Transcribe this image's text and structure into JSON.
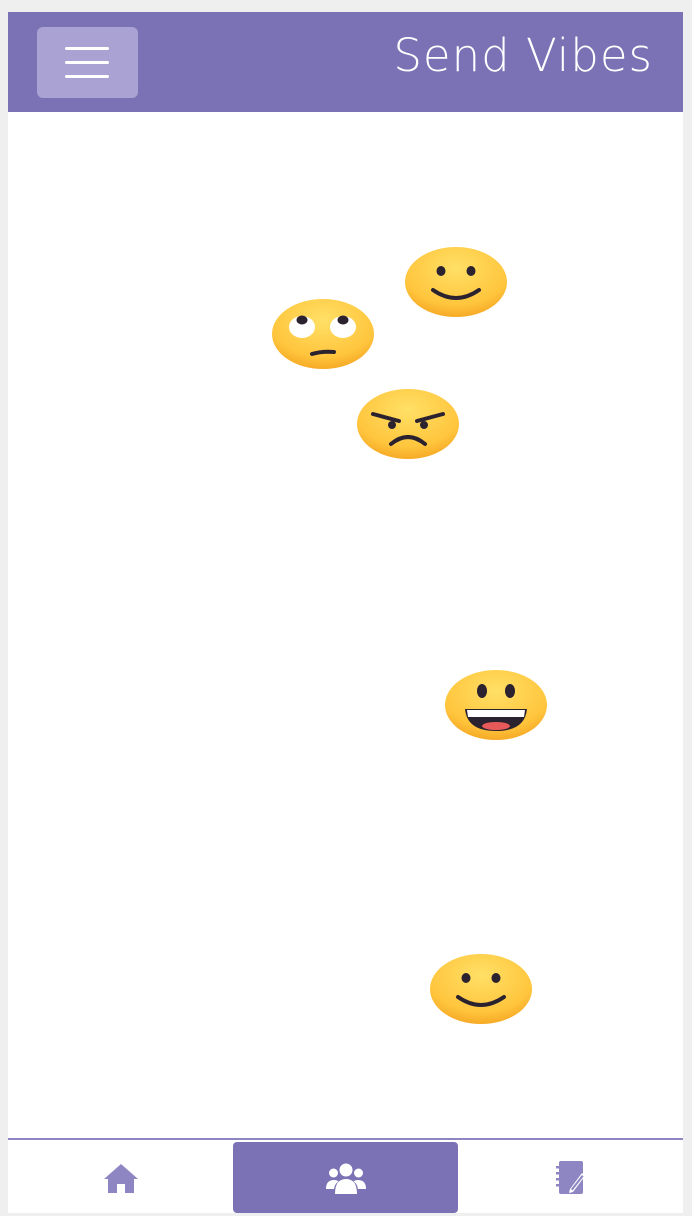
{
  "header": {
    "title": "Send Vibes",
    "menu_icon": "hamburger-menu-icon",
    "background": "#7b72b5"
  },
  "vibes": [
    {
      "emoji": "slightly-smiling-face",
      "label": "🙂"
    },
    {
      "emoji": "face-with-rolling-eyes",
      "label": "🙄"
    },
    {
      "emoji": "angry-face",
      "label": "😠"
    },
    {
      "emoji": "grinning-face",
      "label": "😀"
    },
    {
      "emoji": "slightly-smiling-face",
      "label": "🙂"
    }
  ],
  "bottom_nav": {
    "items": [
      {
        "name": "home",
        "icon": "home-icon",
        "active": false
      },
      {
        "name": "friends",
        "icon": "users-icon",
        "active": true
      },
      {
        "name": "journal",
        "icon": "notebook-edit-icon",
        "active": false
      }
    ],
    "accent": "#7b72b5",
    "inactive_icon_color": "#8e86c2"
  }
}
